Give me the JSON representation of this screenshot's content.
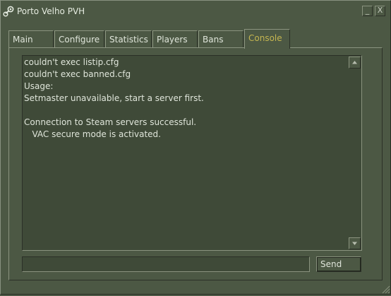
{
  "window": {
    "title": "Porto Velho PVH",
    "minimize_label": "_",
    "close_label": "X",
    "icon": "steam-logo-icon"
  },
  "tabs": [
    {
      "label": "Main",
      "active": false
    },
    {
      "label": "Configure",
      "active": false
    },
    {
      "label": "Statistics",
      "active": false
    },
    {
      "label": "Players",
      "active": false
    },
    {
      "label": "Bans",
      "active": false
    },
    {
      "label": "Console",
      "active": true
    }
  ],
  "console": {
    "lines": [
      "couldn't exec listip.cfg",
      "couldn't exec banned.cfg",
      "Usage:",
      "Setmaster unavailable, start a server first.",
      "",
      "Connection to Steam servers successful.",
      "   VAC secure mode is activated."
    ],
    "command_value": "",
    "send_label": "Send"
  },
  "colors": {
    "background": "#4c5844",
    "console_bg": "#3f4a38",
    "active_tab_text": "#c4b550",
    "text": "#dfe5da"
  }
}
